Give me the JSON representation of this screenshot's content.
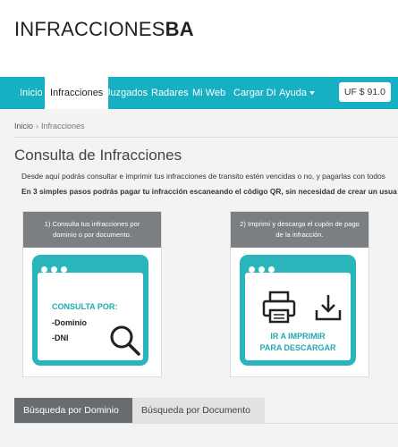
{
  "logo": {
    "light": "INFRACCIONES",
    "bold": "BA"
  },
  "nav": {
    "items": [
      {
        "label": "Inicio"
      },
      {
        "label": "Infracciones"
      },
      {
        "label": "Juzgados"
      },
      {
        "label": "Radares"
      },
      {
        "label": "Mi Web"
      },
      {
        "label": "Cargar DI"
      },
      {
        "label": "Ayuda"
      }
    ],
    "active": "Infracciones",
    "uf_label": "UF $ 91.0"
  },
  "breadcrumb": {
    "home": "Inicio",
    "separator": "›",
    "current": "Infracciones"
  },
  "page": {
    "title": "Consulta de Infracciones",
    "description": "Desde aquí podrás consultar e imprimir tus infracciones de transito estén vencidas o no, y pagarlas con todos",
    "steps_note": "En 3 simples pasos podrás pagar tu infracción escaneando el código QR, sin necesidad de crear un usua"
  },
  "steps": [
    {
      "header": "1) Consulta tus infracciones por dominio o por documento.",
      "ill_title": "CONSULTA POR:",
      "ill_line1": "-Dominio",
      "ill_line2": "-DNI"
    },
    {
      "header": "2) Imprimí y descarga el cupón de pago de la infracción.",
      "ill_line1": "IR A IMPRIMIR",
      "ill_line2": "PARA DESCARGAR"
    }
  ],
  "tabs": [
    {
      "label": "Búsqueda por Dominio"
    },
    {
      "label": "Búsqueda por Documento"
    }
  ],
  "colors": {
    "accent": "#17b0c2",
    "illustration": "#2ab5bd",
    "card_header": "#7b7f81",
    "active_tab": "#696c6e"
  }
}
